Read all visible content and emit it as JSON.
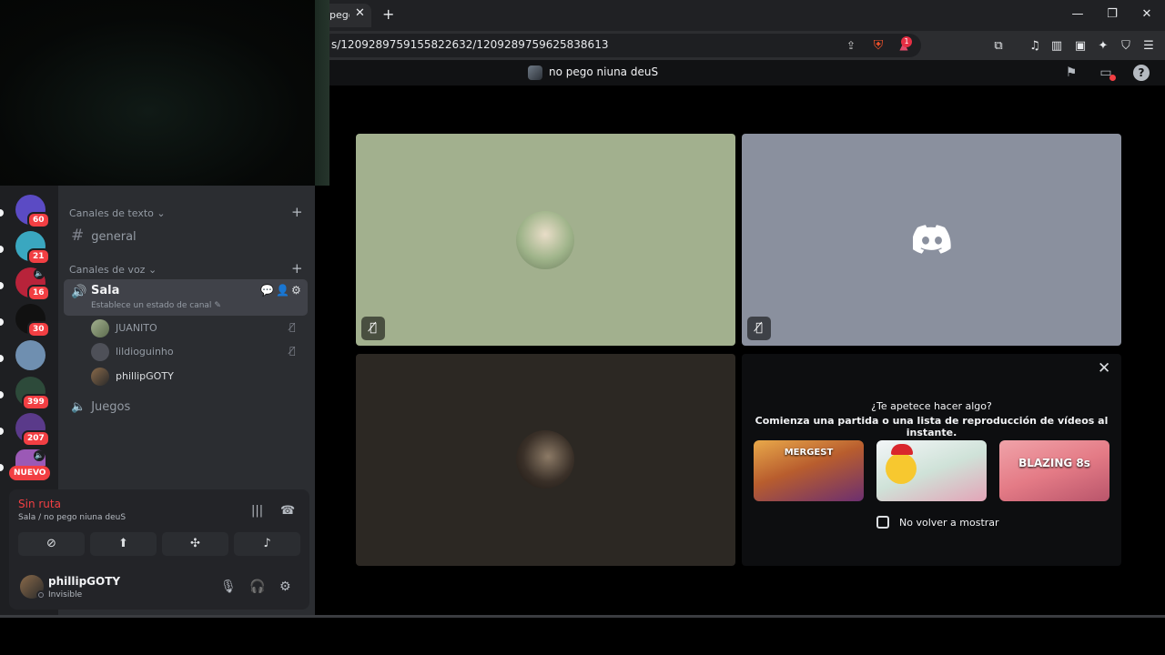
{
  "browser": {
    "tab_title": "pego",
    "tab_close": "✕",
    "new_tab": "+",
    "url": "s/1209289759155822632/1209289759625838613",
    "rewards_count": "1",
    "window_minimize": "—",
    "window_restore": "❐",
    "window_close": "✕"
  },
  "header": {
    "call_name": "no pego niuna deuS"
  },
  "rail": {
    "servers": [
      {
        "badge": "60",
        "color": "#5b4bc4"
      },
      {
        "badge": "21",
        "color": "#3aa7c0"
      },
      {
        "badge": "16",
        "color": "#b8233a"
      },
      {
        "badge": "30",
        "color": "#111111"
      },
      {
        "badge": "",
        "color": "#6f8fb0"
      },
      {
        "badge": "399",
        "color": "#2d4a3a"
      },
      {
        "badge": "207",
        "color": "#5a3a8a"
      },
      {
        "badge": "",
        "color": "#9b59b6"
      }
    ],
    "nuevo_label": "NUEVO"
  },
  "sidebar": {
    "text_category": "Canales de texto",
    "voice_category": "Canales de voz",
    "add": "+",
    "text_channel": "general",
    "hash": "#",
    "voice_channel": "Sala",
    "voice_channel_status": "Establece un estado de canal",
    "members": [
      {
        "name": "JUANITO",
        "muted": true
      },
      {
        "name": "lildioguinho",
        "muted": true
      },
      {
        "name": "phillipGOTY",
        "muted": false
      }
    ],
    "voice_channel_2": "Juegos"
  },
  "voice_panel": {
    "status": "Sin ruta",
    "location": "Sala / no pego niuna deuS"
  },
  "user": {
    "name": "phillipGOTY",
    "status": "Invisible"
  },
  "activity": {
    "question": "¿Te apetece hacer algo?",
    "description": "Comienza una partida o una lista de reproducción de vídeos al instante.",
    "games": [
      {
        "name": "MERGEST KINGDOM",
        "label": "MERGEST"
      },
      {
        "name": "chicken-game",
        "label": ""
      },
      {
        "name": "Blazing 8s",
        "label": "BLAZING 8s"
      }
    ],
    "dont_show_again": "No volver a mostrar",
    "close": "✕"
  },
  "colors": {
    "tile_1": "#a2b08e",
    "tile_2": "#8a909e",
    "tile_3": "#2c2823",
    "discord_blurple": "#ffffff",
    "speaking_green": "#23a55a",
    "danger_red": "#f23f43"
  }
}
